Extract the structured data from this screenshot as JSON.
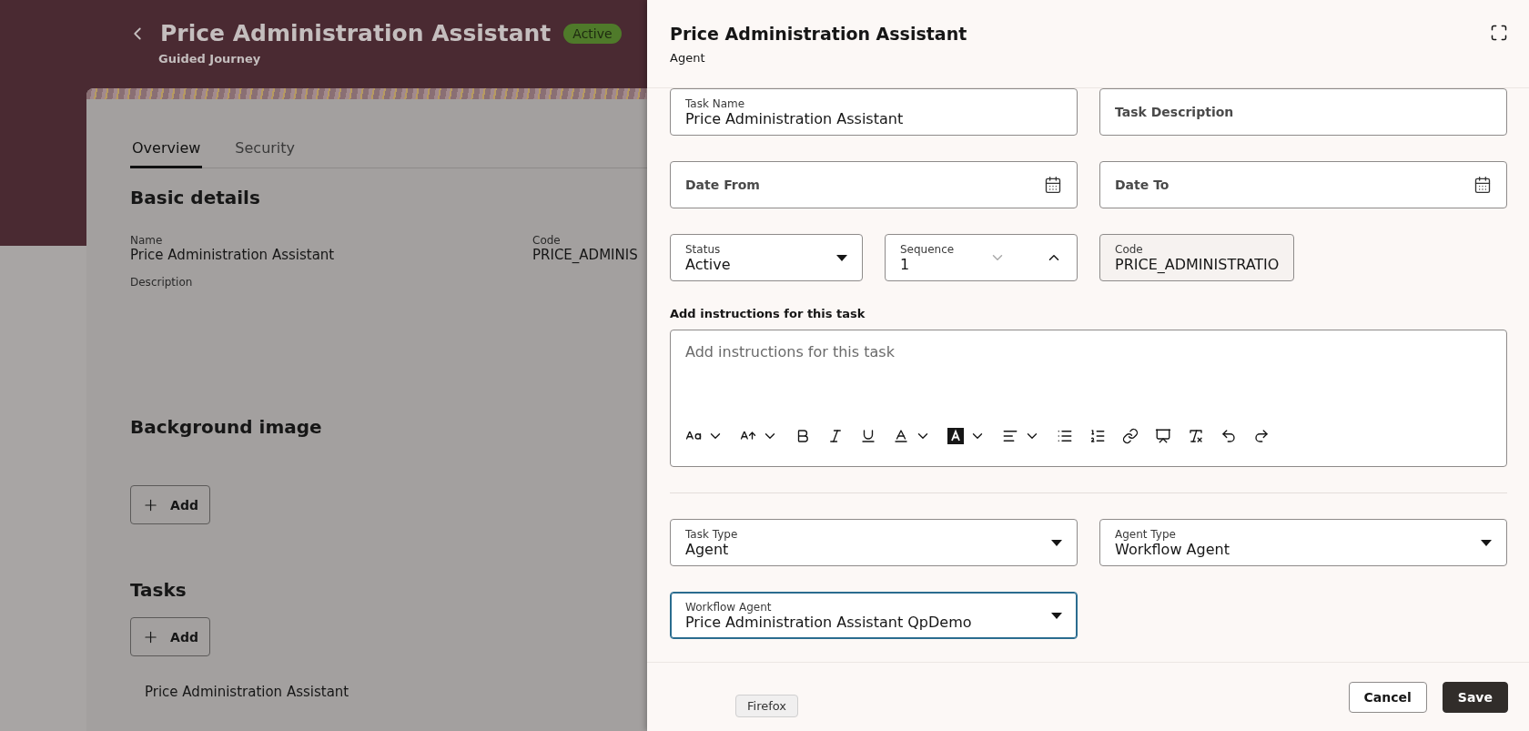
{
  "page": {
    "title": "Price Administration Assistant",
    "status_badge": "Active",
    "subtitle": "Guided Journey",
    "tabs": [
      {
        "label": "Overview",
        "selected": true
      },
      {
        "label": "Security",
        "selected": false
      }
    ],
    "basic_details": {
      "heading": "Basic details",
      "fields": [
        {
          "label": "Name",
          "value": "Price Administration Assistant"
        },
        {
          "label": "Code",
          "value": "PRICE_ADMINIS"
        }
      ],
      "description_label": "Description"
    },
    "background_image": {
      "heading": "Background image",
      "add_button": "Add"
    },
    "tasks": {
      "heading": "Tasks",
      "add_button": "Add",
      "items": [
        "Price Administration Assistant"
      ]
    }
  },
  "drawer": {
    "title": "Price Administration Assistant",
    "subtitle": "Agent",
    "rows": [
      [
        {
          "kind": "text",
          "label": "Task Name",
          "value": "Price Administration Assistant",
          "focused": false
        },
        {
          "kind": "text",
          "label": "Task Description",
          "focused": false
        }
      ],
      [
        {
          "kind": "date",
          "label": "Date From",
          "focused": false
        },
        {
          "kind": "date",
          "label": "Date To",
          "focused": false
        }
      ],
      [
        {
          "kind": "select",
          "label": "Status",
          "value": "Active",
          "focused": false
        },
        {
          "kind": "number",
          "label": "Sequence",
          "value": "1",
          "focused": false
        },
        {
          "kind": "readonly",
          "label": "Code",
          "value": "PRICE_ADMINISTRATIO",
          "focused": false
        }
      ]
    ],
    "instructions": {
      "label": "Add instructions for this task",
      "placeholder": "Add instructions for this task"
    },
    "rows_after": [
      [
        {
          "kind": "select",
          "label": "Task Type",
          "value": "Agent",
          "focused": false
        },
        {
          "kind": "select",
          "label": "Agent Type",
          "value": "Workflow Agent",
          "focused": false
        }
      ],
      [
        {
          "kind": "select",
          "label": "Workflow Agent",
          "value": "Price Administration Assistant QpDemo",
          "focused": true
        }
      ]
    ],
    "buttons": [
      {
        "label": "Cancel",
        "kind": "secondary"
      },
      {
        "label": "Save",
        "kind": "primary"
      }
    ]
  },
  "tooltip": "Firefox"
}
